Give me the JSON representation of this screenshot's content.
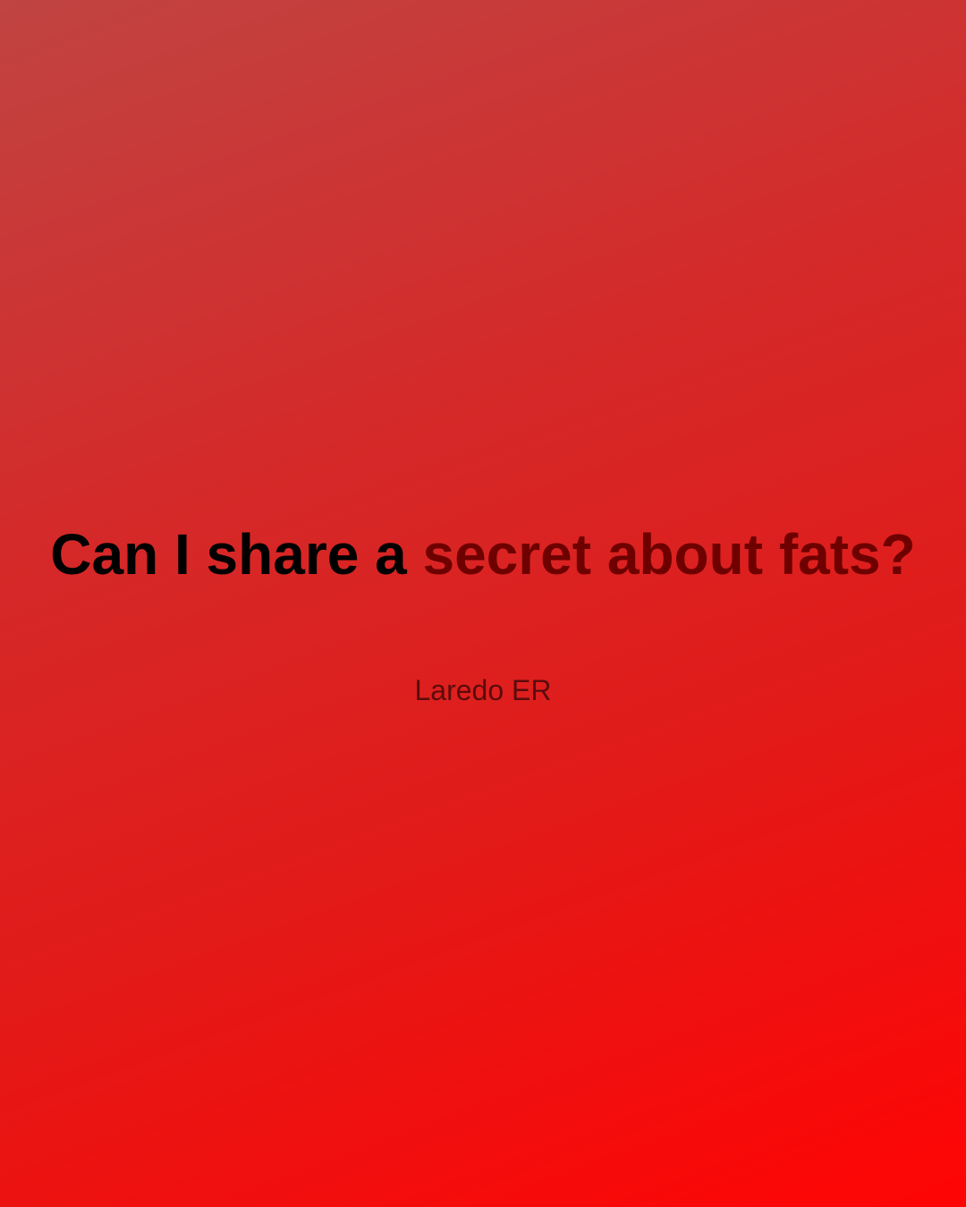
{
  "post": {
    "headline_lead": "Can I share a ",
    "headline_accent": "secret about fats?",
    "byline": "Laredo ER"
  },
  "colors": {
    "background_start": "#c04442",
    "background_end": "#ff0404",
    "headline_text": "#000000",
    "headline_accent_text": "#6e0000",
    "byline_text": "#5c0b0b"
  }
}
